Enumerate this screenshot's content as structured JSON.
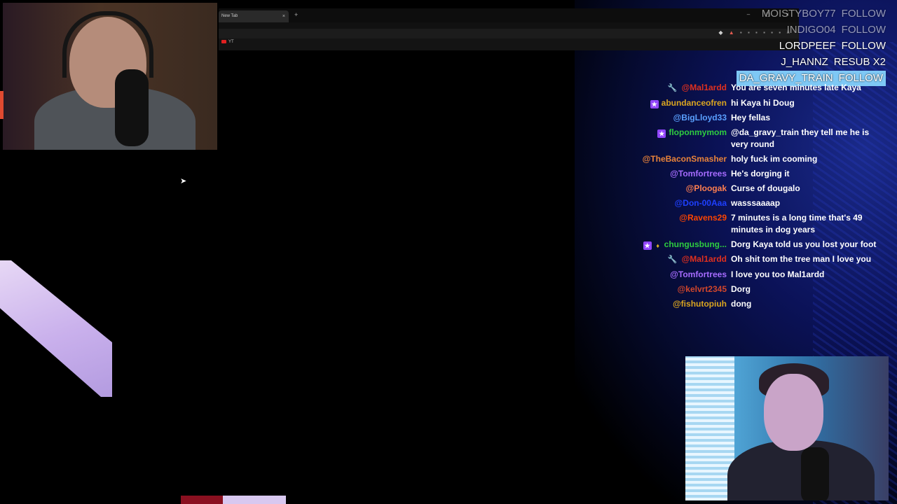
{
  "browser": {
    "tab_title": "New Tab",
    "tab_close": "×",
    "new_tab": "+",
    "window_controls": "– ◻ ×",
    "bookmark_label": "YT"
  },
  "alerts": [
    {
      "user": "MOISTYBOY77",
      "action": "FOLLOW"
    },
    {
      "user": "INDIGO04",
      "action": "FOLLOW"
    },
    {
      "user": "LORDPEEF",
      "action": "FOLLOW"
    },
    {
      "user": "J_HANNZ",
      "action": "RESUB X2"
    },
    {
      "user": "DA_GRAVY_TRAIN",
      "action": "FOLLOW"
    }
  ],
  "chat": [
    {
      "user": "@Mal1ardd",
      "color": "#e0301e",
      "text": "You are seven minutes late Kaya"
    },
    {
      "user": "abundanceofren",
      "color": "#daa520",
      "text": "hi Kaya hi Doug"
    },
    {
      "user": "@BigLloyd33",
      "color": "#5aa0ff",
      "text": "Hey fellas"
    },
    {
      "user": "floponmymom",
      "color": "#2ecc40",
      "text": "@da_gravy_train they tell me he is very round"
    },
    {
      "user": "@TheBaconSmasher",
      "color": "#e8833a",
      "text": "holy fuck im cooming"
    },
    {
      "user": "@Tomfortrees",
      "color": "#a66cff",
      "text": "He's dorging it"
    },
    {
      "user": "@Ploogak",
      "color": "#ff7f50",
      "text": "Curse of dougalo"
    },
    {
      "user": "@Don-00Aaa",
      "color": "#1e40ff",
      "text": "wasssaaaap"
    },
    {
      "user": "@Ravens29",
      "color": "#ff4500",
      "text": "7 minutes is a long time that's 49 minutes in dog years"
    },
    {
      "user": "chungusbung...",
      "color": "#2ecc40",
      "text": "Dorg Kaya told us you lost your foot"
    },
    {
      "user": "@Mal1ardd",
      "color": "#e0301e",
      "text": "Oh shit tom the tree man I love you"
    },
    {
      "user": "@Tomfortrees",
      "color": "#a66cff",
      "text": "I love you too Mal1ardd"
    },
    {
      "user": "@kelvrt2345",
      "color": "#d2462b",
      "text": "Dorg"
    },
    {
      "user": "@fishutopiuh",
      "color": "#daa520",
      "text": "dong"
    }
  ],
  "icons": {
    "wrench": "🔧",
    "star": "★",
    "gem": "♦",
    "cursor": "➤"
  }
}
